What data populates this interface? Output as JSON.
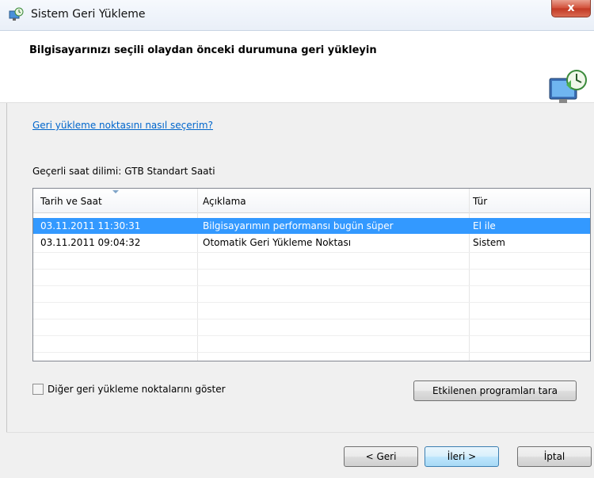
{
  "window": {
    "title": "Sistem Geri Yükleme",
    "close_symbol": "x"
  },
  "header": {
    "title": "Bilgisayarınızı seçili olaydan önceki durumuna geri yükleyin"
  },
  "help_link": "Geri yükleme noktasını nasıl seçerim?",
  "timezone": {
    "label": "Geçerli saat dilimi:",
    "value": "GTB Standart Saati"
  },
  "table": {
    "columns": [
      "Tarih ve Saat",
      "Açıklama",
      "Tür"
    ],
    "sorted_column": "Tarih ve Saat",
    "rows": [
      {
        "date": "03.11.2011 11:30:31",
        "desc": "Bilgisayarımın performansı bugün süper",
        "type": "El ile",
        "selected": true
      },
      {
        "date": "03.11.2011 09:04:32",
        "desc": "Otomatik Geri Yükleme Noktası",
        "type": "Sistem",
        "selected": false
      }
    ]
  },
  "show_more": {
    "label": "Diğer geri yükleme noktalarını göster",
    "checked": false
  },
  "buttons": {
    "scan": "Etkilenen programları tara",
    "back": "< Geri",
    "next": "İleri >",
    "cancel": "İptal"
  },
  "colors": {
    "selection": "#3399ff",
    "link": "#0066cc"
  }
}
